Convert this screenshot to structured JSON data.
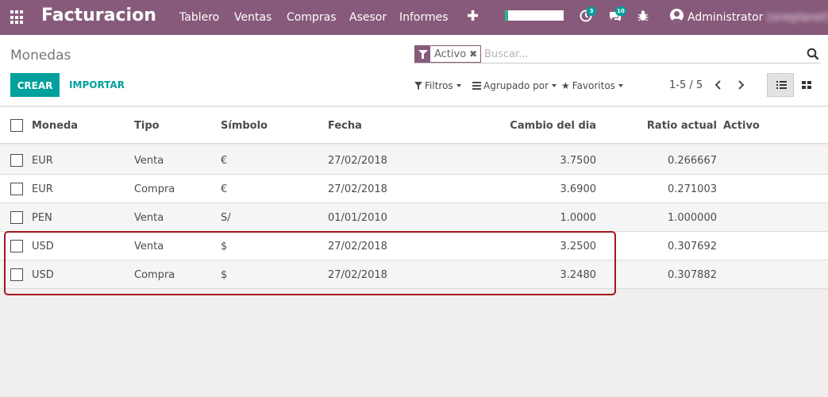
{
  "navbar": {
    "app_title": "Facturacion",
    "menus": [
      "Tablero",
      "Ventas",
      "Compras",
      "Asesor",
      "Informes"
    ],
    "activity_count": "3",
    "messages_count": "10",
    "user_name": "Administrator",
    "user_db": "(oneplanet)",
    "brand_color": "#875a7b",
    "progress_fraction": 0.05
  },
  "control_panel": {
    "breadcrumb": "Monedas",
    "search": {
      "facet_value": "Activo",
      "placeholder": "Buscar..."
    },
    "buttons": {
      "create": "CREAR",
      "import": "IMPORTAR"
    },
    "filters_label": "Filtros",
    "groupby_label": "Agrupado por",
    "favorites_label": "Favoritos",
    "pager": "1-5 / 5",
    "accent_color": "#00a09d"
  },
  "table": {
    "columns": [
      "Moneda",
      "Tipo",
      "Símbolo",
      "Fecha",
      "Cambio del dia",
      "Ratio actual",
      "Activo"
    ],
    "rows": [
      [
        "EUR",
        "Venta",
        "€",
        "27/02/2018",
        "3.7500",
        "0.266667"
      ],
      [
        "EUR",
        "Compra",
        "€",
        "27/02/2018",
        "3.6900",
        "0.271003"
      ],
      [
        "PEN",
        "Venta",
        "S/",
        "01/01/2010",
        "1.0000",
        "1.000000"
      ],
      [
        "USD",
        "Venta",
        "$",
        "27/02/2018",
        "3.2500",
        "0.307692"
      ],
      [
        "USD",
        "Compra",
        "$",
        "27/02/2018",
        "3.2480",
        "0.307882"
      ]
    ],
    "highlight_color": "#a3171c"
  }
}
